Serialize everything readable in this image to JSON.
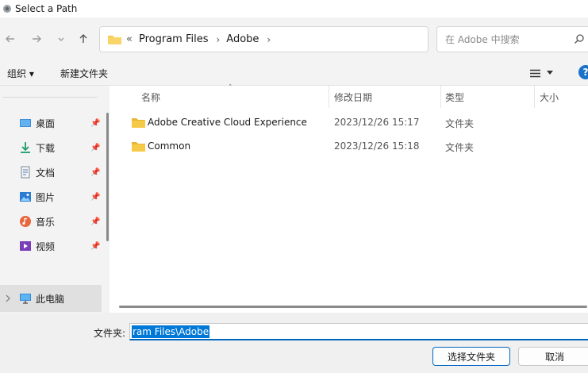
{
  "window": {
    "title": "Select a Path"
  },
  "navigation": {
    "back_icon": "arrow-left-icon",
    "forward_icon": "arrow-right-icon",
    "recent_icon": "chevron-down-icon",
    "up_icon": "arrow-up-icon"
  },
  "address": {
    "overflow": "«",
    "crumbs": [
      "Program Files",
      "Adobe"
    ],
    "separator": "›"
  },
  "search": {
    "placeholder": "在 Adobe 中搜索"
  },
  "toolbar": {
    "organize_label": "组织 ▾",
    "new_folder_label": "新建文件夹",
    "help_label": "?"
  },
  "sidebar": {
    "items": [
      {
        "label": "桌面",
        "icon": "desktop-icon"
      },
      {
        "label": "下载",
        "icon": "download-icon"
      },
      {
        "label": "文档",
        "icon": "document-icon"
      },
      {
        "label": "图片",
        "icon": "pictures-icon"
      },
      {
        "label": "音乐",
        "icon": "music-icon"
      },
      {
        "label": "视频",
        "icon": "video-icon"
      }
    ],
    "this_pc_label": "此电脑",
    "pin_glyph": "📌"
  },
  "columns": {
    "name": "名称",
    "date_modified": "修改日期",
    "type": "类型",
    "size": "大小"
  },
  "files": [
    {
      "name": "Adobe Creative Cloud Experience",
      "date": "2023/12/26 15:17",
      "type": "文件夹"
    },
    {
      "name": "Common",
      "date": "2023/12/26 15:18",
      "type": "文件夹"
    }
  ],
  "footer": {
    "folder_label": "文件夹:",
    "folder_value": "ram Files\\Adobe",
    "select_button": "选择文件夹",
    "cancel_button": "取消"
  },
  "colors": {
    "accent": "#0067c0",
    "selection": "#0078d7",
    "folder": "#f7c948"
  }
}
